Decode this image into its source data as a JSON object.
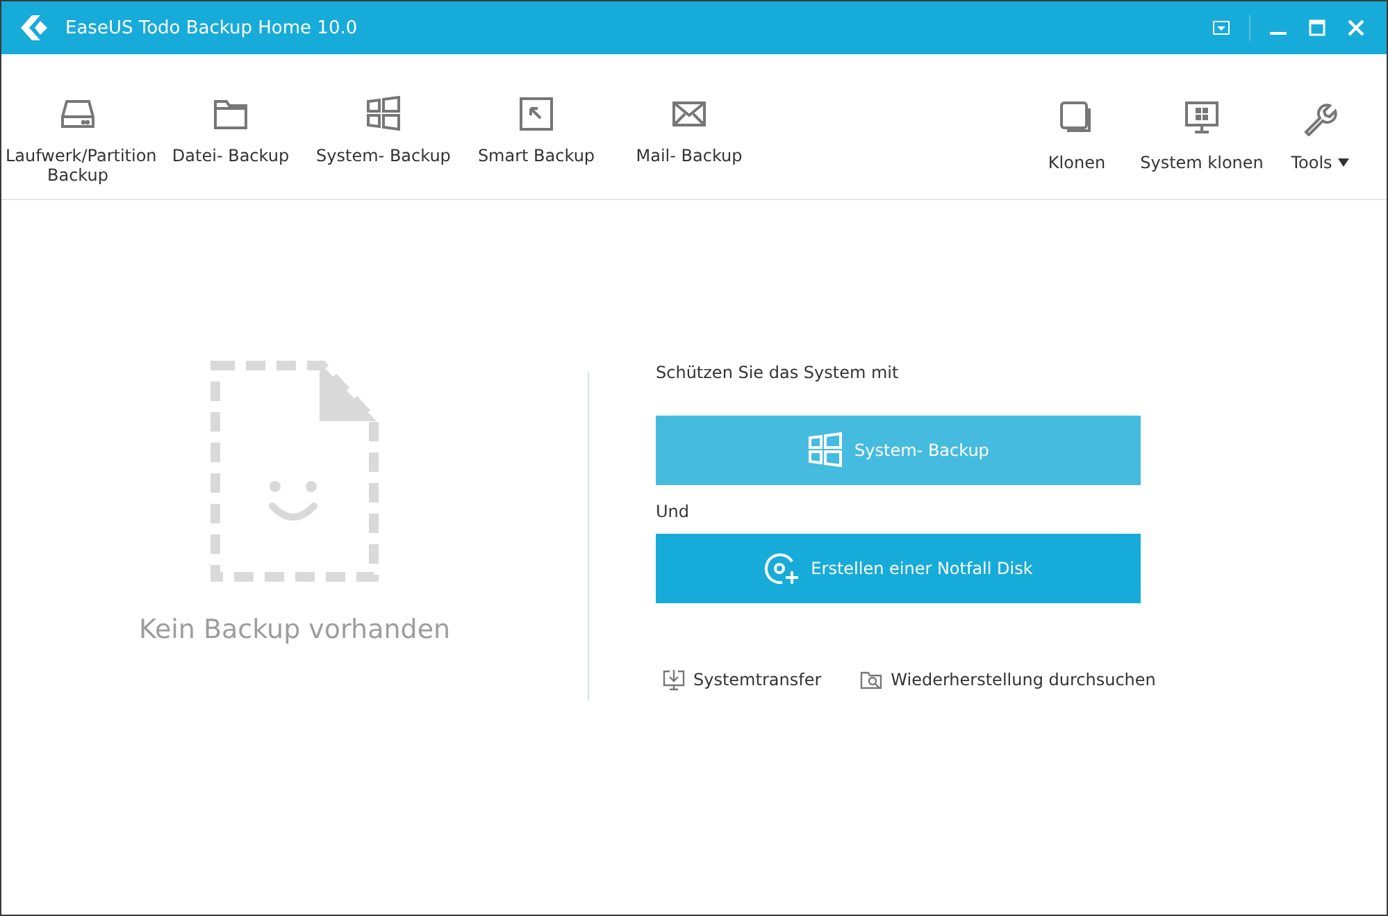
{
  "window": {
    "title": "EaseUS Todo Backup Home 10.0"
  },
  "toolbar": {
    "left": [
      {
        "label": "Laufwerk/Partition Backup"
      },
      {
        "label": "Datei- Backup"
      },
      {
        "label": "System- Backup"
      },
      {
        "label": "Smart Backup"
      },
      {
        "label": "Mail- Backup"
      }
    ],
    "right": [
      {
        "label": "Klonen",
        "has_menu": false
      },
      {
        "label": "System klonen",
        "has_menu": false
      },
      {
        "label": "Tools",
        "has_menu": true
      }
    ]
  },
  "empty_state": {
    "message": "Kein Backup vorhanden"
  },
  "actions": {
    "heading": "Schützen Sie das System mit",
    "connector": "Und",
    "buttons": [
      {
        "kind": "windows",
        "label": "System- Backup",
        "hovered": true
      },
      {
        "kind": "disk",
        "label": "Erstellen einer Notfall Disk",
        "hovered": false
      }
    ],
    "links": [
      {
        "kind": "transfer",
        "label": "Systemtransfer"
      },
      {
        "kind": "browse",
        "label": "Wiederherstellung durchsuchen"
      }
    ]
  }
}
